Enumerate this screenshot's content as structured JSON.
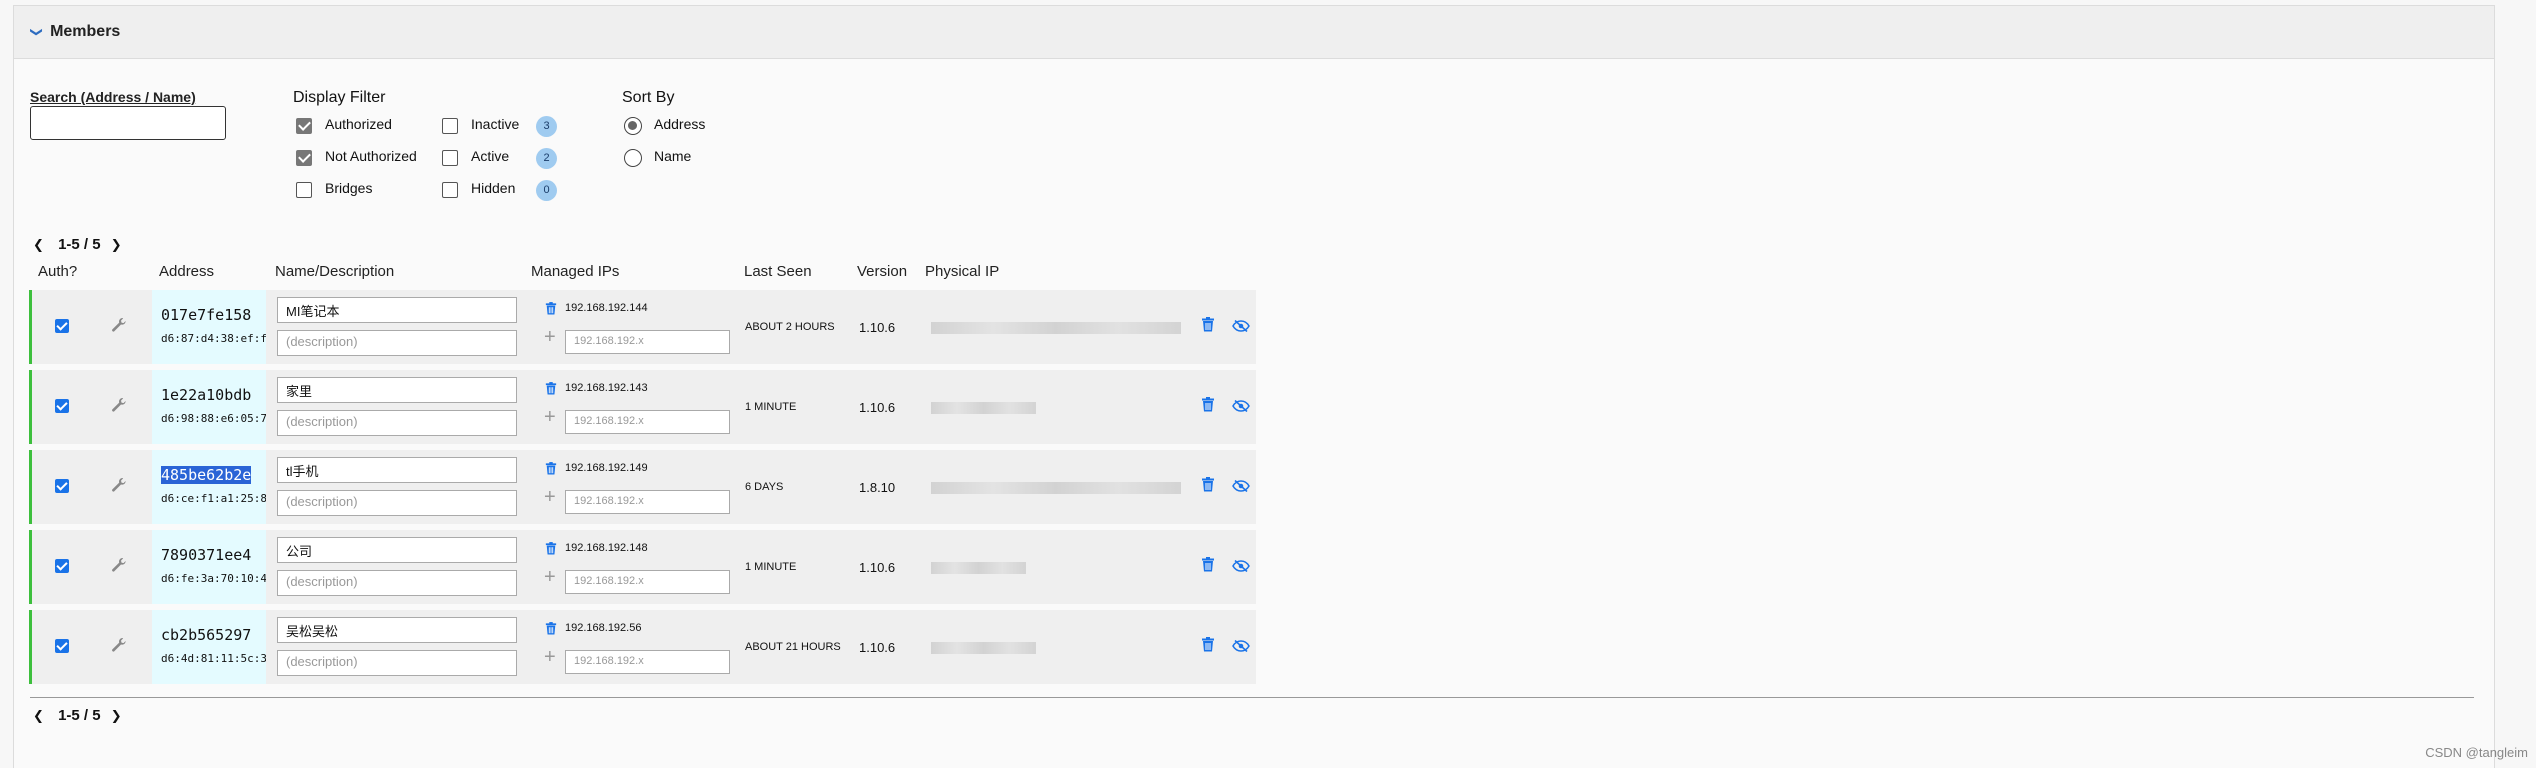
{
  "panel": {
    "title": "Members"
  },
  "search": {
    "label": "Search (Address / Name)",
    "value": ""
  },
  "display_filter": {
    "title": "Display Filter",
    "authorized": {
      "label": "Authorized",
      "checked": true
    },
    "not_authorized": {
      "label": "Not Authorized",
      "checked": true
    },
    "bridges": {
      "label": "Bridges",
      "checked": false
    },
    "inactive": {
      "label": "Inactive",
      "count": "3",
      "checked": false
    },
    "active": {
      "label": "Active",
      "count": "2",
      "checked": false
    },
    "hidden": {
      "label": "Hidden",
      "count": "0",
      "checked": false
    }
  },
  "sort_by": {
    "title": "Sort By",
    "address": {
      "label": "Address",
      "selected": true
    },
    "name": {
      "label": "Name",
      "selected": false
    }
  },
  "pager": {
    "top": "1-5 / 5",
    "bottom": "1-5 / 5"
  },
  "columns": {
    "auth": "Auth?",
    "address": "Address",
    "name": "Name/Description",
    "managed_ips": "Managed IPs",
    "last_seen": "Last Seen",
    "version": "Version",
    "physical_ip": "Physical IP"
  },
  "members": [
    {
      "id": "017e7fe158",
      "mac": "d6:87:d4:38:ef:f",
      "name": "MI笔记本",
      "desc_placeholder": "(description)",
      "ip": "192.168.192.144",
      "ip_placeholder": "192.168.192.x",
      "last_seen": "ABOUT 2 HOURS",
      "version": "1.10.6",
      "selected": false
    },
    {
      "id": "1e22a10bdb",
      "mac": "d6:98:88:e6:05:7",
      "name": "家里",
      "desc_placeholder": "(description)",
      "ip": "192.168.192.143",
      "ip_placeholder": "192.168.192.x",
      "last_seen": "1 MINUTE",
      "version": "1.10.6",
      "selected": false
    },
    {
      "id": "485be62b2e",
      "mac": "d6:ce:f1:a1:25:8",
      "name": "tl手机",
      "desc_placeholder": "(description)",
      "ip": "192.168.192.149",
      "ip_placeholder": "192.168.192.x",
      "last_seen": "6 DAYS",
      "version": "1.8.10",
      "selected": true
    },
    {
      "id": "7890371ee4",
      "mac": "d6:fe:3a:70:10:4",
      "name": "公司",
      "desc_placeholder": "(description)",
      "ip": "192.168.192.148",
      "ip_placeholder": "192.168.192.x",
      "last_seen": "1 MINUTE",
      "version": "1.10.6",
      "selected": false
    },
    {
      "id": "cb2b565297",
      "mac": "d6:4d:81:11:5c:3",
      "name": "吴松吴松",
      "desc_placeholder": "(description)",
      "ip": "192.168.192.56",
      "ip_placeholder": "192.168.192.x",
      "last_seen": "ABOUT 21 HOURS",
      "version": "1.10.6",
      "selected": false
    }
  ],
  "watermark": "CSDN @tangleim"
}
